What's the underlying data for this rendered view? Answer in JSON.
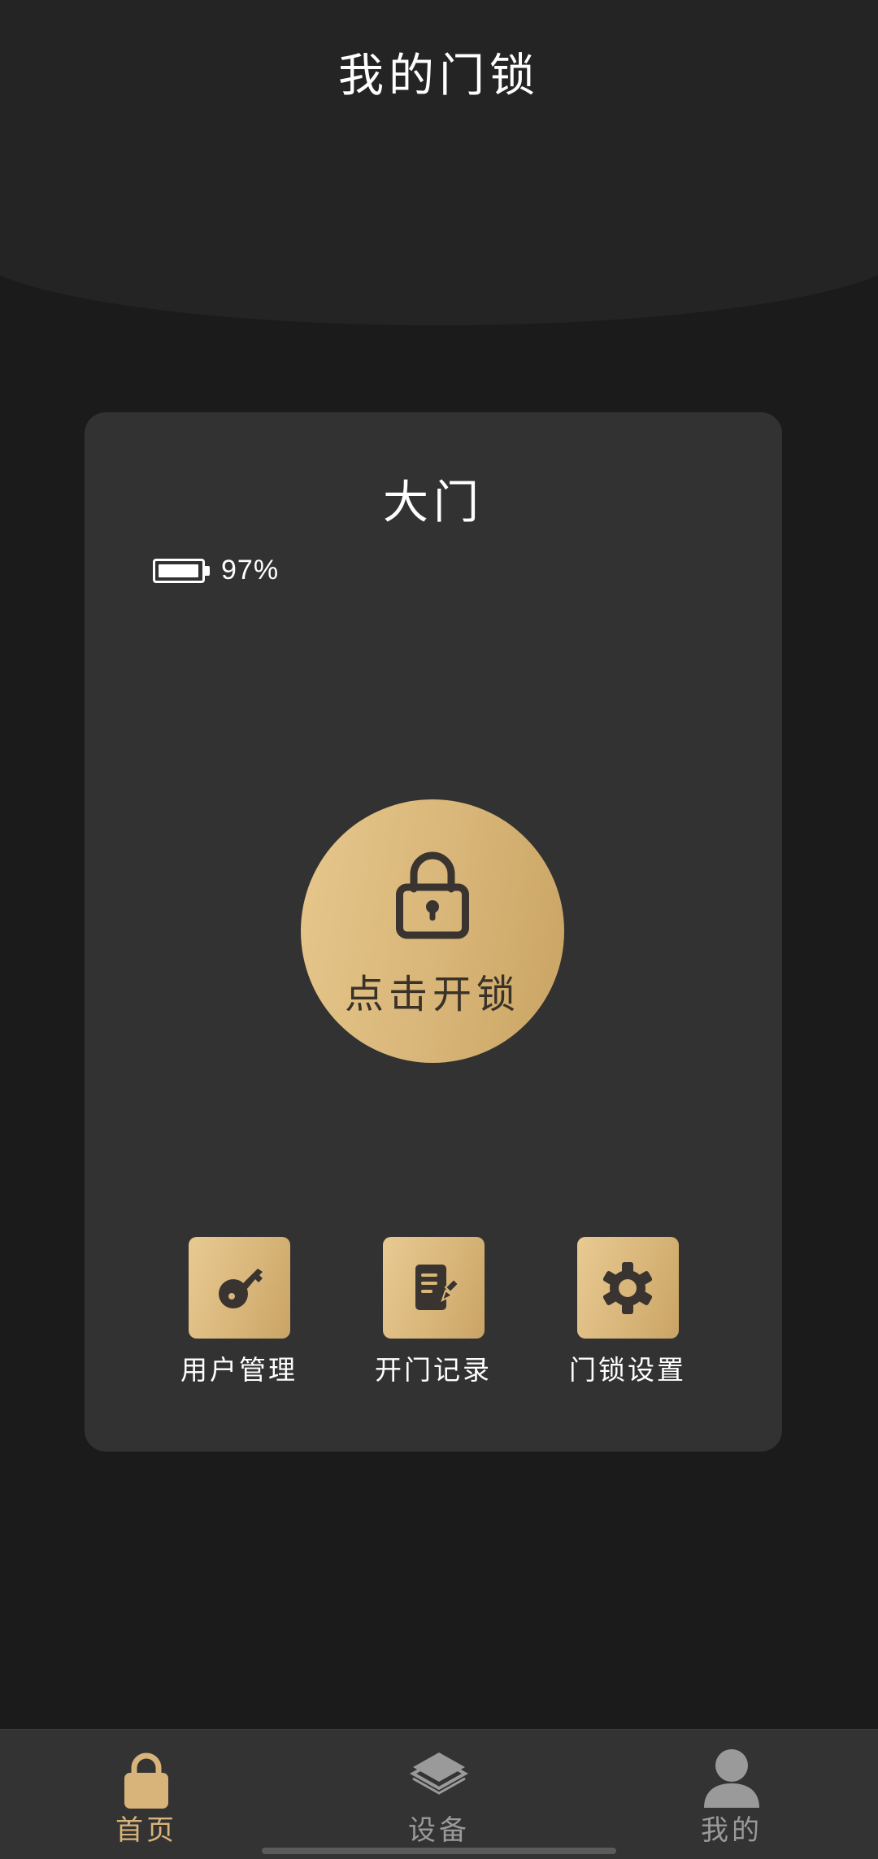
{
  "header": {
    "title": "我的门锁"
  },
  "card": {
    "door_name": "大门",
    "battery": {
      "percent_text": "97%",
      "level": 0.97
    },
    "unlock": {
      "icon": "lock-icon",
      "label": "点击开锁"
    },
    "actions": [
      {
        "icon": "key-icon",
        "label": "用户管理"
      },
      {
        "icon": "document-edit-icon",
        "label": "开门记录"
      },
      {
        "icon": "gear-icon",
        "label": "门锁设置"
      }
    ]
  },
  "tabbar": {
    "items": [
      {
        "icon": "lock-icon",
        "label": "首页",
        "active": true
      },
      {
        "icon": "layers-icon",
        "label": "设备",
        "active": false
      },
      {
        "icon": "user-icon",
        "label": "我的",
        "active": false
      }
    ],
    "active_color": "#d9b47a",
    "inactive_color": "#9a9a9a"
  },
  "colors": {
    "background": "#1b1b1b",
    "header": "#242424",
    "card": "#323232",
    "gold": "#d9b67a"
  }
}
